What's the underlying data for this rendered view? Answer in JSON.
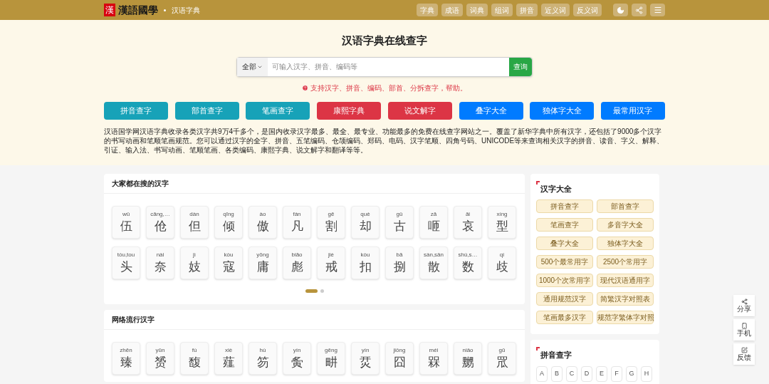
{
  "header": {
    "logo_mark": "漢",
    "logo_text": "漢語國學",
    "section": "汉语字典",
    "nav": [
      "字典",
      "成语",
      "词典",
      "组词",
      "拼音",
      "近义词",
      "反义词"
    ]
  },
  "hero": {
    "title": "汉语字典在线查字",
    "search": {
      "scope": "全部",
      "placeholder": "可输入汉字、拼音、编码等",
      "button": "查询"
    },
    "hint": "支持汉字、拼音、编码、部首、分拆查字，帮助。",
    "buttons": [
      {
        "label": "拼音查字",
        "color": "#17a2b8"
      },
      {
        "label": "部首查字",
        "color": "#17a2b8"
      },
      {
        "label": "笔画查字",
        "color": "#17a2b8"
      },
      {
        "label": "康熙字典",
        "color": "#dc3545"
      },
      {
        "label": "说文解字",
        "color": "#dc3545"
      },
      {
        "label": "叠字大全",
        "color": "#007bff"
      },
      {
        "label": "独体字大全",
        "color": "#007bff"
      },
      {
        "label": "最常用汉字",
        "color": "#007bff"
      }
    ],
    "description": "汉语国学网汉语字典收录各类汉字共9万4千多个，是国内收录汉字最多、最全、最专业、功能最多的免费在线查字网站之一。覆盖了新华字典中所有汉字，还包括了9000多个汉字的书写动画和笔顺笔画规范。您可以通过汉字的全字、拼音、五笔编码、仓颉编码、郑码、电码、汉字笔顺、四角号码、UNICODE等来查询相关汉字的拼音、读音、字义、解释、引证、输入法、书写动画、笔顺笔画、各类编码、康熙字典、说文解字和翻译等等。"
  },
  "popular": {
    "title": "大家都在搜的汉字",
    "chars": [
      {
        "pinyin": "wǔ",
        "char": "伍"
      },
      {
        "pinyin": "cāng,…",
        "char": "伧"
      },
      {
        "pinyin": "dàn",
        "char": "但"
      },
      {
        "pinyin": "qīng",
        "char": "倾"
      },
      {
        "pinyin": "ào",
        "char": "傲"
      },
      {
        "pinyin": "fán",
        "char": "凡"
      },
      {
        "pinyin": "gē",
        "char": "割"
      },
      {
        "pinyin": "què",
        "char": "却"
      },
      {
        "pinyin": "gǔ",
        "char": "古"
      },
      {
        "pinyin": "zā",
        "char": "咂"
      },
      {
        "pinyin": "āi",
        "char": "哀"
      },
      {
        "pinyin": "xíng",
        "char": "型"
      },
      {
        "pinyin": "tóu,tou",
        "char": "头"
      },
      {
        "pinyin": "nài",
        "char": "奈"
      },
      {
        "pinyin": "jì",
        "char": "妓"
      },
      {
        "pinyin": "kòu",
        "char": "寇"
      },
      {
        "pinyin": "yōng",
        "char": "庸"
      },
      {
        "pinyin": "biāo",
        "char": "彪"
      },
      {
        "pinyin": "jiè",
        "char": "戒"
      },
      {
        "pinyin": "kòu",
        "char": "扣"
      },
      {
        "pinyin": "bā",
        "char": "捌"
      },
      {
        "pinyin": "sàn,sǎn",
        "char": "散"
      },
      {
        "pinyin": "shù,s…",
        "char": "数"
      },
      {
        "pinyin": "qí",
        "char": "歧"
      }
    ],
    "pager": [
      {
        "selected": true
      },
      {
        "selected": false
      }
    ]
  },
  "trending": {
    "title": "网络流行汉字",
    "chars": [
      {
        "pinyin": "zhēn",
        "char": "臻"
      },
      {
        "pinyin": "yūn",
        "char": "赟"
      },
      {
        "pinyin": "fù",
        "char": "馥"
      },
      {
        "pinyin": "xiè",
        "char": "薤"
      },
      {
        "pinyin": "hù",
        "char": "笏"
      },
      {
        "pinyin": "yín",
        "char": "夤"
      },
      {
        "pinyin": "gēng",
        "char": "畊"
      },
      {
        "pinyin": "yín",
        "char": "烎"
      },
      {
        "pinyin": "jiǒng",
        "char": "囧"
      },
      {
        "pinyin": "méi",
        "char": "槑"
      },
      {
        "pinyin": "niǎo",
        "char": "嬲"
      },
      {
        "pinyin": "gū",
        "char": "罛"
      }
    ]
  },
  "sidebar": {
    "all_chars": {
      "title": "汉字大全",
      "links": [
        "拼音查字",
        "部首查字",
        "笔画查字",
        "多音字大全",
        "叠字大全",
        "独体字大全",
        "500个最常用字",
        "2500个常用字",
        "1000个次常用字",
        "现代汉语通用字",
        "通用规范汉字",
        "简繁汉字对照表",
        "笔画最多汉字",
        "规范字繁体字对照"
      ]
    },
    "pinyin": {
      "title": "拼音查字",
      "letters": [
        "A",
        "B",
        "C",
        "D",
        "E",
        "F",
        "G",
        "H"
      ]
    }
  },
  "float_tools": [
    {
      "kind": "share",
      "label": "分享"
    },
    {
      "kind": "phone",
      "label": "手机"
    },
    {
      "kind": "feedback",
      "label": "反馈"
    }
  ]
}
